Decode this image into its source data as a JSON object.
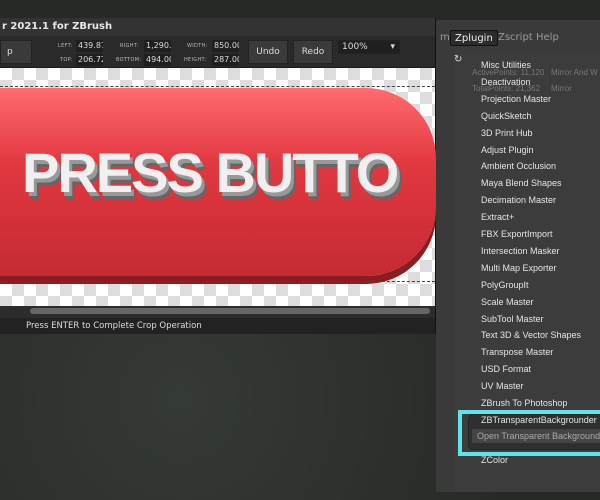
{
  "window": {
    "title": "r 2021.1 for ZBrush",
    "status": "Press ENTER to Complete Crop Operation",
    "canvas_text": "PRESS BUTTO"
  },
  "toolbar": {
    "crop_label": "p",
    "left_label": "LEFT:",
    "left": "439.87",
    "top_label": "TOP:",
    "top": "206.72",
    "right_label": "RIGHT:",
    "right": "1,290.0",
    "bottom_label": "BOTTOM:",
    "bottom": "494.00",
    "width_label": "WIDTH:",
    "width": "850.00",
    "height_label": "HEIGHT:",
    "height": "287.00",
    "undo": "Undo",
    "redo": "Redo",
    "zoom": "100%"
  },
  "menubar": {
    "partial": "m",
    "items": [
      "Zplugin",
      "Zscript",
      "Help"
    ],
    "active": "Zplugin"
  },
  "background_info": {
    "active_points": "ActivePoints: 11,120",
    "total_points": "TotalPoints: 21,362",
    "mirror_and_weld": "Mirror And W",
    "mirror": "Mirror"
  },
  "zplugin_menu": {
    "items": [
      "Misc Utilities",
      "Deactivation",
      "Projection Master",
      "QuickSketch",
      "3D Print Hub",
      "Adjust Plugin",
      "Ambient Occlusion",
      "Maya Blend Shapes",
      "Decimation Master",
      "Extract+",
      "FBX ExportImport",
      "Intersection Masker",
      "Multi Map Exporter",
      "PolyGroupIt",
      "Scale Master",
      "SubTool Master",
      "Text 3D & Vector Shapes",
      "Transpose Master",
      "USD Format",
      "UV Master",
      "ZBrush To Photoshop",
      "ZBTransparentBackgrounder"
    ],
    "highlighted_sub": "Open Transparent Backgrounder",
    "last": "ZColor",
    "highlight_color": "#5fe3ea",
    "brand_color": "#e23840"
  }
}
